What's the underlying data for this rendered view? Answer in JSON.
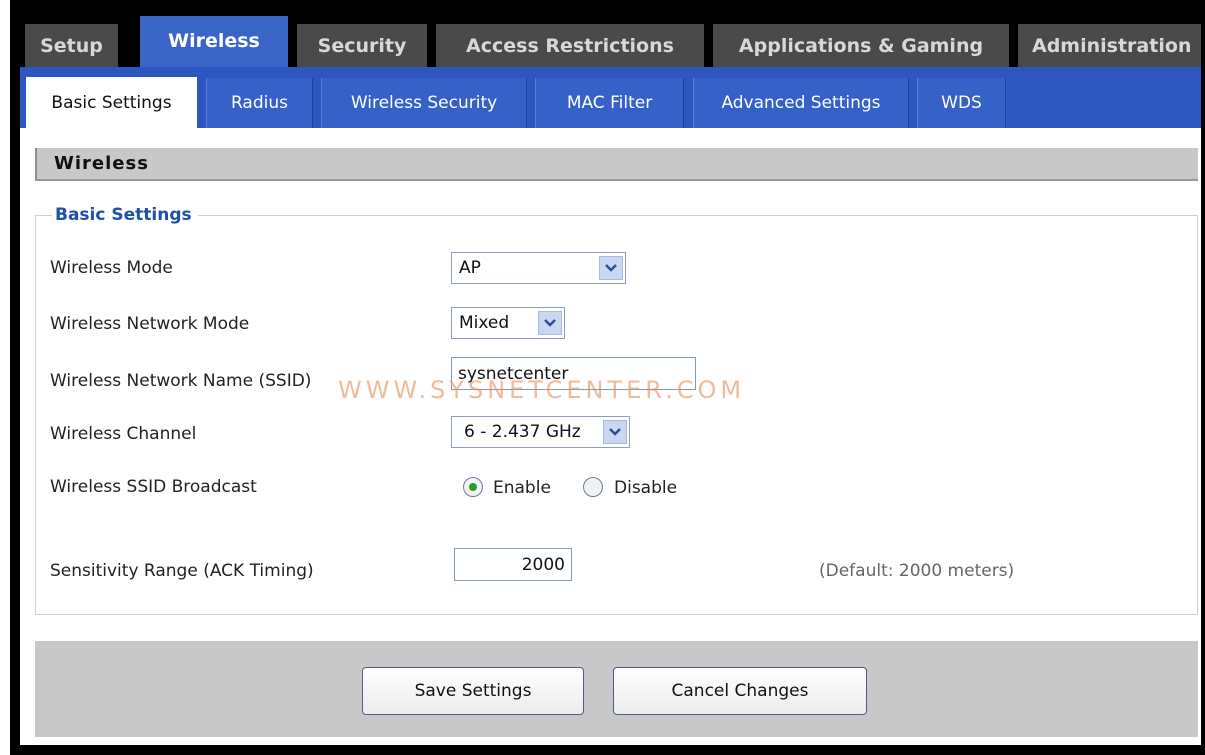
{
  "top_tabs": [
    {
      "label": "Setup",
      "active": false
    },
    {
      "label": "Wireless",
      "active": true
    },
    {
      "label": "Security",
      "active": false
    },
    {
      "label": "Access Restrictions",
      "active": false
    },
    {
      "label": "Applications & Gaming",
      "active": false
    },
    {
      "label": "Administration",
      "active": false
    }
  ],
  "sub_tabs": [
    {
      "label": "Basic Settings",
      "active": true
    },
    {
      "label": "Radius",
      "active": false
    },
    {
      "label": "Wireless Security",
      "active": false
    },
    {
      "label": "MAC Filter",
      "active": false
    },
    {
      "label": "Advanced Settings",
      "active": false
    },
    {
      "label": "WDS",
      "active": false
    }
  ],
  "section_title": "Wireless",
  "basic_settings": {
    "legend": "Basic Settings",
    "wireless_mode": {
      "label": "Wireless Mode",
      "value": "AP"
    },
    "network_mode": {
      "label": "Wireless Network Mode",
      "value": "Mixed"
    },
    "ssid": {
      "label": "Wireless Network Name (SSID)",
      "value": "sysnetcenter"
    },
    "channel": {
      "label": "Wireless Channel",
      "value": "6 - 2.437 GHz"
    },
    "ssid_broadcast": {
      "label": "Wireless SSID Broadcast",
      "enable_label": "Enable",
      "disable_label": "Disable",
      "selected": "Enable"
    },
    "sensitivity": {
      "label": "Sensitivity Range (ACK Timing)",
      "value": "2000",
      "hint": "(Default: 2000 meters)"
    }
  },
  "watermark": "WWW.SYSNETCENTER.COM",
  "buttons": {
    "save": "Save Settings",
    "cancel": "Cancel Changes"
  },
  "colors": {
    "active_tab": "#3a64c6",
    "sub_bar": "#2c57c0",
    "legend": "#1f4fb0",
    "radio_selected": "#2e9a2e"
  }
}
